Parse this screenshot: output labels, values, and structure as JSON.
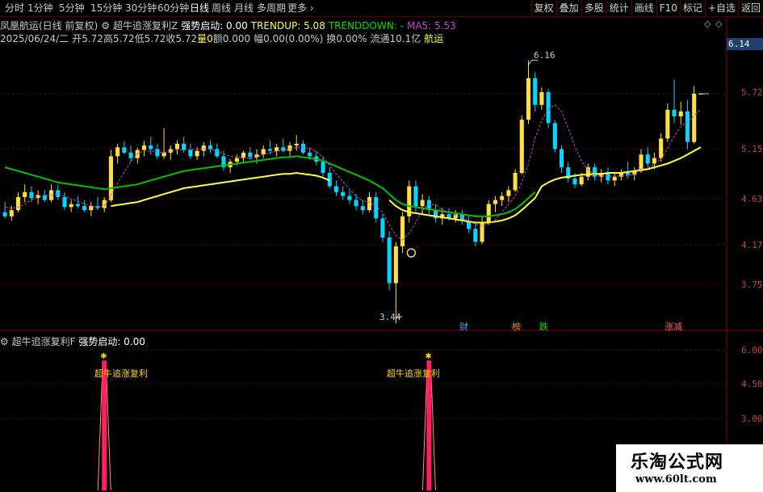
{
  "toolbar": {
    "periods": [
      "分时",
      "1分钟",
      "5分钟",
      "15分钟",
      "30分钟",
      "60分钟",
      "日线",
      "周线",
      "月线",
      "多周期",
      "更多"
    ],
    "active_period": "日线",
    "more_arrow": "›",
    "tools": [
      "复权",
      "叠加",
      "多股",
      "统计",
      "画线",
      "F10",
      "标记",
      "+自选",
      "返回"
    ]
  },
  "header": {
    "stock_name": "凤凰航运(日线 前复权)",
    "indicator_name": "超牛追涨复利Z",
    "strong_start": "强势启动: 0.00",
    "trendup": "TRENDUP: 5.08",
    "trenddown": "TRENDDOWN: -",
    "ma5": "MA5: 5.53",
    "date": "2025/06/24/二",
    "open": "开5.72",
    "high": "高5.72",
    "low": "低5.72",
    "close": "收5.72",
    "vol": "量0",
    "amount": "额0.000",
    "amp": "幅0.00(0.00%)",
    "turnover": "换0.00%",
    "float": "流通10.1亿",
    "sector": "航运",
    "diamond": "◇",
    "diamond2": "◇"
  },
  "axis": {
    "price_labels": [
      "5.72",
      "5.15",
      "4.63",
      "4.17",
      "3.75"
    ],
    "current_price": "6.14",
    "high_label": "6.16",
    "low_label": "3.44",
    "ind_labels": [
      "6.00",
      "4.50",
      "3.00"
    ]
  },
  "events": [
    {
      "text": "财",
      "color": "#4da6ff"
    },
    {
      "text": "榜",
      "color": "#ff8c00"
    },
    {
      "text": "跌",
      "color": "#00e000"
    },
    {
      "text": "涨减",
      "color": "#ff6060"
    }
  ],
  "indicator": {
    "title": "超牛追涨复利F",
    "value": "强势启动: 0.00",
    "signal_label": "超牛追涨复利"
  },
  "watermark": {
    "line1": "乐淘公式网",
    "line2": "www.60lt.com"
  },
  "colors": {
    "up": "#ffe040",
    "down": "#00d8ff",
    "ma_green": "#00c000",
    "ma_yellow": "#ffff40",
    "ma5": "#d040d0",
    "grid": "#7a0000",
    "signal": "#ff2060"
  },
  "chart_data": {
    "type": "candlestick",
    "price_range": [
      3.4,
      6.2
    ],
    "candles": [
      {
        "o": 4.4,
        "h": 4.5,
        "l": 4.34,
        "c": 4.36
      },
      {
        "o": 4.36,
        "h": 4.46,
        "l": 4.32,
        "c": 4.42
      },
      {
        "o": 4.42,
        "h": 4.6,
        "l": 4.4,
        "c": 4.55
      },
      {
        "o": 4.55,
        "h": 4.68,
        "l": 4.5,
        "c": 4.6
      },
      {
        "o": 4.6,
        "h": 4.66,
        "l": 4.5,
        "c": 4.54
      },
      {
        "o": 4.54,
        "h": 4.62,
        "l": 4.48,
        "c": 4.57
      },
      {
        "o": 4.57,
        "h": 4.62,
        "l": 4.5,
        "c": 4.52
      },
      {
        "o": 4.52,
        "h": 4.68,
        "l": 4.5,
        "c": 4.62
      },
      {
        "o": 4.62,
        "h": 4.68,
        "l": 4.52,
        "c": 4.55
      },
      {
        "o": 4.55,
        "h": 4.6,
        "l": 4.42,
        "c": 4.45
      },
      {
        "o": 4.45,
        "h": 4.52,
        "l": 4.4,
        "c": 4.48
      },
      {
        "o": 4.48,
        "h": 4.56,
        "l": 4.44,
        "c": 4.46
      },
      {
        "o": 4.46,
        "h": 4.52,
        "l": 4.4,
        "c": 4.42
      },
      {
        "o": 4.42,
        "h": 4.5,
        "l": 4.36,
        "c": 4.46
      },
      {
        "o": 4.46,
        "h": 4.55,
        "l": 4.42,
        "c": 4.44
      },
      {
        "o": 4.44,
        "h": 4.55,
        "l": 4.4,
        "c": 4.52
      },
      {
        "o": 4.52,
        "h": 5.05,
        "l": 4.5,
        "c": 4.98
      },
      {
        "o": 4.98,
        "h": 5.12,
        "l": 4.9,
        "c": 5.08
      },
      {
        "o": 5.08,
        "h": 5.15,
        "l": 5.0,
        "c": 5.02
      },
      {
        "o": 5.02,
        "h": 5.1,
        "l": 4.92,
        "c": 4.96
      },
      {
        "o": 4.96,
        "h": 5.08,
        "l": 4.9,
        "c": 5.05
      },
      {
        "o": 5.05,
        "h": 5.15,
        "l": 4.98,
        "c": 5.1
      },
      {
        "o": 5.1,
        "h": 5.2,
        "l": 5.0,
        "c": 5.06
      },
      {
        "o": 5.06,
        "h": 5.12,
        "l": 4.95,
        "c": 4.98
      },
      {
        "o": 4.98,
        "h": 5.3,
        "l": 4.95,
        "c": 5.02
      },
      {
        "o": 5.02,
        "h": 5.1,
        "l": 4.94,
        "c": 5.06
      },
      {
        "o": 5.06,
        "h": 5.16,
        "l": 5.0,
        "c": 5.12
      },
      {
        "o": 5.12,
        "h": 5.2,
        "l": 5.02,
        "c": 5.05
      },
      {
        "o": 5.05,
        "h": 5.12,
        "l": 4.95,
        "c": 4.98
      },
      {
        "o": 4.98,
        "h": 5.08,
        "l": 4.94,
        "c": 5.04
      },
      {
        "o": 5.04,
        "h": 5.14,
        "l": 4.98,
        "c": 5.1
      },
      {
        "o": 5.1,
        "h": 5.16,
        "l": 5.02,
        "c": 5.06
      },
      {
        "o": 5.06,
        "h": 5.12,
        "l": 4.96,
        "c": 4.98
      },
      {
        "o": 4.98,
        "h": 5.04,
        "l": 4.82,
        "c": 4.86
      },
      {
        "o": 4.86,
        "h": 4.95,
        "l": 4.8,
        "c": 4.92
      },
      {
        "o": 4.92,
        "h": 5.0,
        "l": 4.88,
        "c": 4.96
      },
      {
        "o": 4.96,
        "h": 5.04,
        "l": 4.9,
        "c": 5.02
      },
      {
        "o": 5.02,
        "h": 5.08,
        "l": 4.94,
        "c": 4.97
      },
      {
        "o": 4.97,
        "h": 5.06,
        "l": 4.9,
        "c": 5.0
      },
      {
        "o": 5.0,
        "h": 5.1,
        "l": 4.96,
        "c": 5.06
      },
      {
        "o": 5.06,
        "h": 5.16,
        "l": 5.0,
        "c": 5.04
      },
      {
        "o": 5.04,
        "h": 5.12,
        "l": 4.98,
        "c": 5.08
      },
      {
        "o": 5.08,
        "h": 5.18,
        "l": 5.02,
        "c": 5.04
      },
      {
        "o": 5.04,
        "h": 5.14,
        "l": 4.98,
        "c": 5.1
      },
      {
        "o": 5.1,
        "h": 5.22,
        "l": 5.04,
        "c": 5.12
      },
      {
        "o": 5.12,
        "h": 5.16,
        "l": 5.0,
        "c": 5.02
      },
      {
        "o": 5.02,
        "h": 5.08,
        "l": 4.94,
        "c": 4.98
      },
      {
        "o": 4.98,
        "h": 5.04,
        "l": 4.88,
        "c": 4.92
      },
      {
        "o": 4.92,
        "h": 4.98,
        "l": 4.76,
        "c": 4.8
      },
      {
        "o": 4.8,
        "h": 4.86,
        "l": 4.64,
        "c": 4.66
      },
      {
        "o": 4.66,
        "h": 4.72,
        "l": 4.56,
        "c": 4.6
      },
      {
        "o": 4.6,
        "h": 4.66,
        "l": 4.52,
        "c": 4.56
      },
      {
        "o": 4.56,
        "h": 4.62,
        "l": 4.48,
        "c": 4.52
      },
      {
        "o": 4.52,
        "h": 4.58,
        "l": 4.42,
        "c": 4.46
      },
      {
        "o": 4.46,
        "h": 4.52,
        "l": 4.38,
        "c": 4.42
      },
      {
        "o": 4.42,
        "h": 4.6,
        "l": 4.4,
        "c": 4.55
      },
      {
        "o": 4.55,
        "h": 4.6,
        "l": 4.3,
        "c": 4.34
      },
      {
        "o": 4.34,
        "h": 4.38,
        "l": 4.12,
        "c": 4.16
      },
      {
        "o": 4.16,
        "h": 4.22,
        "l": 3.7,
        "c": 3.76
      },
      {
        "o": 3.76,
        "h": 4.12,
        "l": 3.44,
        "c": 4.08
      },
      {
        "o": 4.08,
        "h": 4.4,
        "l": 4.02,
        "c": 4.36
      },
      {
        "o": 4.36,
        "h": 4.72,
        "l": 4.3,
        "c": 4.66
      },
      {
        "o": 4.66,
        "h": 4.72,
        "l": 4.4,
        "c": 4.46
      },
      {
        "o": 4.46,
        "h": 4.58,
        "l": 4.38,
        "c": 4.52
      },
      {
        "o": 4.52,
        "h": 4.56,
        "l": 4.38,
        "c": 4.42
      },
      {
        "o": 4.42,
        "h": 4.48,
        "l": 4.3,
        "c": 4.34
      },
      {
        "o": 4.34,
        "h": 4.44,
        "l": 4.28,
        "c": 4.38
      },
      {
        "o": 4.38,
        "h": 4.44,
        "l": 4.32,
        "c": 4.34
      },
      {
        "o": 4.34,
        "h": 4.42,
        "l": 4.3,
        "c": 4.38
      },
      {
        "o": 4.38,
        "h": 4.42,
        "l": 4.28,
        "c": 4.32
      },
      {
        "o": 4.32,
        "h": 4.36,
        "l": 4.2,
        "c": 4.24
      },
      {
        "o": 4.24,
        "h": 4.3,
        "l": 4.08,
        "c": 4.12
      },
      {
        "o": 4.12,
        "h": 4.36,
        "l": 4.1,
        "c": 4.3
      },
      {
        "o": 4.3,
        "h": 4.52,
        "l": 4.28,
        "c": 4.48
      },
      {
        "o": 4.48,
        "h": 4.56,
        "l": 4.4,
        "c": 4.52
      },
      {
        "o": 4.52,
        "h": 4.6,
        "l": 4.46,
        "c": 4.56
      },
      {
        "o": 4.56,
        "h": 4.66,
        "l": 4.5,
        "c": 4.62
      },
      {
        "o": 4.62,
        "h": 4.84,
        "l": 4.6,
        "c": 4.8
      },
      {
        "o": 4.8,
        "h": 5.45,
        "l": 4.78,
        "c": 5.4
      },
      {
        "o": 5.4,
        "h": 6.16,
        "l": 5.35,
        "c": 5.92
      },
      {
        "o": 5.92,
        "h": 6.0,
        "l": 5.5,
        "c": 5.58
      },
      {
        "o": 5.58,
        "h": 5.8,
        "l": 5.52,
        "c": 5.74
      },
      {
        "o": 5.74,
        "h": 5.78,
        "l": 5.3,
        "c": 5.36
      },
      {
        "o": 5.36,
        "h": 5.4,
        "l": 5.02,
        "c": 5.06
      },
      {
        "o": 5.06,
        "h": 5.1,
        "l": 4.8,
        "c": 4.86
      },
      {
        "o": 4.86,
        "h": 4.92,
        "l": 4.7,
        "c": 4.74
      },
      {
        "o": 4.74,
        "h": 4.8,
        "l": 4.64,
        "c": 4.68
      },
      {
        "o": 4.68,
        "h": 4.8,
        "l": 4.66,
        "c": 4.76
      },
      {
        "o": 4.76,
        "h": 4.9,
        "l": 4.72,
        "c": 4.86
      },
      {
        "o": 4.86,
        "h": 4.9,
        "l": 4.72,
        "c": 4.76
      },
      {
        "o": 4.76,
        "h": 4.84,
        "l": 4.7,
        "c": 4.8
      },
      {
        "o": 4.8,
        "h": 4.86,
        "l": 4.68,
        "c": 4.72
      },
      {
        "o": 4.72,
        "h": 4.8,
        "l": 4.66,
        "c": 4.76
      },
      {
        "o": 4.76,
        "h": 4.84,
        "l": 4.72,
        "c": 4.8
      },
      {
        "o": 4.8,
        "h": 4.92,
        "l": 4.74,
        "c": 4.78
      },
      {
        "o": 4.78,
        "h": 4.86,
        "l": 4.72,
        "c": 4.82
      },
      {
        "o": 4.82,
        "h": 5.06,
        "l": 4.8,
        "c": 5.0
      },
      {
        "o": 5.0,
        "h": 5.08,
        "l": 4.86,
        "c": 4.9
      },
      {
        "o": 4.9,
        "h": 5.02,
        "l": 4.84,
        "c": 4.96
      },
      {
        "o": 4.96,
        "h": 5.24,
        "l": 4.92,
        "c": 5.18
      },
      {
        "o": 5.18,
        "h": 5.6,
        "l": 5.14,
        "c": 5.52
      },
      {
        "o": 5.52,
        "h": 5.9,
        "l": 5.36,
        "c": 5.44
      },
      {
        "o": 5.44,
        "h": 5.62,
        "l": 5.34,
        "c": 5.5
      },
      {
        "o": 5.5,
        "h": 5.64,
        "l": 5.06,
        "c": 5.14
      },
      {
        "o": 5.14,
        "h": 5.82,
        "l": 5.12,
        "c": 5.72
      },
      {
        "o": 5.72,
        "h": 5.72,
        "l": 5.72,
        "c": 5.72
      }
    ],
    "ma_green": [
      4.86,
      4.84,
      4.82,
      4.8,
      4.78,
      4.76,
      4.74,
      4.72,
      4.7,
      4.69,
      4.68,
      4.67,
      4.66,
      4.65,
      4.64,
      4.63,
      4.64,
      4.65,
      4.66,
      4.67,
      4.68,
      4.7,
      4.72,
      4.74,
      4.76,
      4.78,
      4.8,
      4.82,
      4.83,
      4.84,
      4.85,
      4.86,
      4.87,
      4.88,
      4.89,
      4.9,
      4.91,
      4.92,
      4.93,
      4.94,
      4.95,
      4.96,
      4.97,
      4.97,
      4.98,
      4.97,
      4.96,
      4.95,
      4.93,
      4.9,
      4.87,
      4.84,
      4.81,
      4.78,
      4.75,
      4.72,
      4.68,
      4.64,
      4.58,
      4.52,
      4.48,
      4.46,
      4.45,
      4.44,
      4.43,
      4.42,
      4.41,
      4.4,
      4.39,
      4.38,
      4.37,
      4.36,
      4.36,
      4.36,
      4.37,
      4.38,
      4.4,
      4.43,
      4.48,
      4.54,
      4.6,
      4.66,
      4.7,
      4.73,
      4.75,
      4.76,
      4.77,
      4.78,
      4.78,
      4.79,
      4.79,
      4.8,
      4.8,
      4.8,
      4.81,
      4.82,
      4.83,
      4.84,
      4.86,
      4.88,
      4.9,
      4.93,
      4.96,
      5.0,
      5.04,
      5.08
    ],
    "ma5": [
      4.45,
      4.44,
      4.45,
      4.48,
      4.52,
      4.55,
      4.56,
      4.57,
      4.58,
      4.56,
      4.53,
      4.51,
      4.48,
      4.46,
      4.45,
      4.46,
      4.57,
      4.69,
      4.81,
      4.92,
      5.01,
      5.04,
      5.04,
      5.03,
      5.02,
      5.04,
      5.05,
      5.05,
      5.05,
      5.06,
      5.06,
      5.06,
      5.04,
      5.01,
      4.98,
      4.97,
      4.97,
      4.95,
      4.97,
      5.0,
      5.02,
      5.04,
      5.04,
      5.06,
      5.08,
      5.08,
      5.07,
      5.03,
      4.97,
      4.88,
      4.79,
      4.71,
      4.63,
      4.56,
      4.51,
      4.5,
      4.46,
      4.4,
      4.28,
      4.18,
      4.14,
      4.2,
      4.3,
      4.42,
      4.48,
      4.47,
      4.42,
      4.4,
      4.37,
      4.35,
      4.32,
      4.28,
      4.27,
      4.29,
      4.33,
      4.4,
      4.48,
      4.56,
      4.7,
      4.9,
      5.18,
      5.39,
      5.53,
      5.58,
      5.5,
      5.3,
      5.09,
      4.93,
      4.83,
      4.78,
      4.77,
      4.77,
      4.76,
      4.77,
      4.77,
      4.79,
      4.84,
      4.85,
      4.89,
      4.95,
      5.07,
      5.21,
      5.32,
      5.38,
      5.45,
      5.53
    ],
    "signals": [
      15,
      64
    ]
  }
}
